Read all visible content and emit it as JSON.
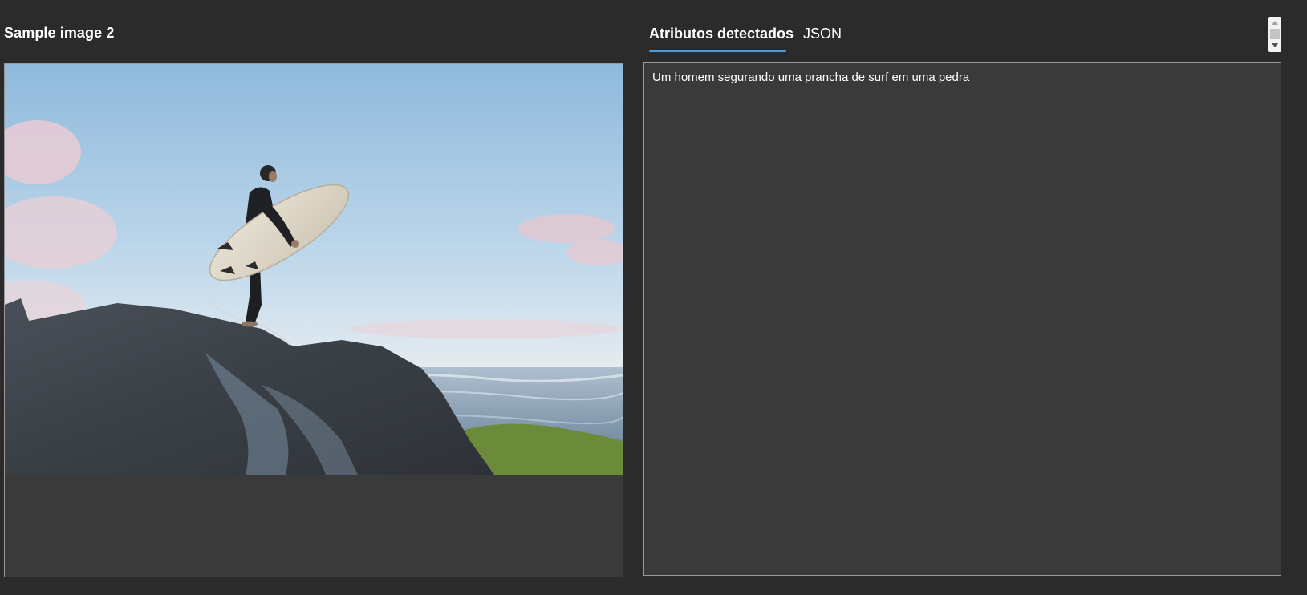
{
  "left_panel": {
    "title": "Sample image 2"
  },
  "tabs": [
    {
      "label": "Atributos detectados",
      "active": true
    },
    {
      "label": "JSON",
      "active": false
    }
  ],
  "result": {
    "caption": "Um homem segurando uma prancha de surf em uma pedra"
  },
  "colors": {
    "background": "#2b2b2b",
    "panel": "#3a3a3a",
    "accent": "#4a9ce0",
    "border": "#9a9a9a"
  }
}
